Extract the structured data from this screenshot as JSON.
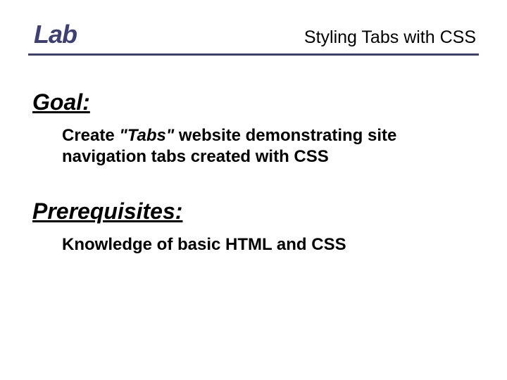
{
  "header": {
    "label": "Lab",
    "title": "Styling Tabs with CSS"
  },
  "goal": {
    "heading": "Goal:",
    "body_prefix": "Create  ",
    "body_emphasis": "\"Tabs\"",
    "body_suffix": " website demonstrating site navigation tabs created with CSS"
  },
  "prerequisites": {
    "heading": "Prerequisites:",
    "body": "Knowledge of basic HTML and CSS"
  }
}
